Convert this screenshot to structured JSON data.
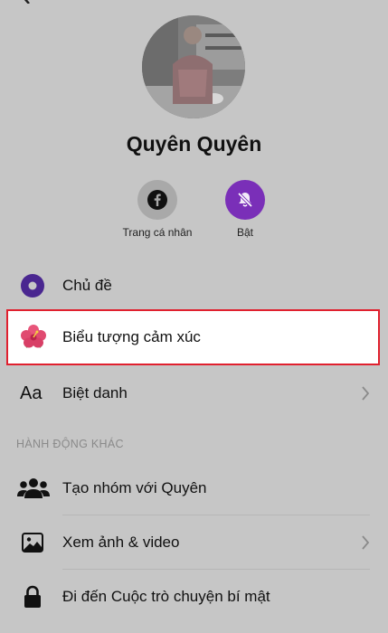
{
  "profile": {
    "name": "Quyên Quyên"
  },
  "quick_actions": [
    {
      "label": "Trang cá nhân",
      "icon": "facebook-icon",
      "color": "#9e9e9e"
    },
    {
      "label": "Bật",
      "icon": "bell-muted-icon",
      "color": "#8a2bd0"
    }
  ],
  "menu": {
    "theme": {
      "label": "Chủ đề",
      "icon": "theme-circle-icon",
      "color": "#5a2fa8"
    },
    "emoji": {
      "label": "Biểu tượng cảm xúc",
      "icon": "hibiscus-icon"
    },
    "nickname": {
      "label": "Biệt danh",
      "icon": "text-aa-icon",
      "glyph": "Aa"
    }
  },
  "other_actions": {
    "header": "HÀNH ĐỘNG KHÁC",
    "items": [
      {
        "label": "Tạo nhóm với Quyên",
        "icon": "group-icon"
      },
      {
        "label": "Xem ảnh & video",
        "icon": "photo-icon"
      },
      {
        "label": "Đi đến Cuộc trò chuyện bí mật",
        "icon": "lock-icon"
      }
    ]
  },
  "colors": {
    "background": "#c6c6c6",
    "highlight_border": "#e0202e",
    "accent_purple": "#8a2bd0"
  }
}
